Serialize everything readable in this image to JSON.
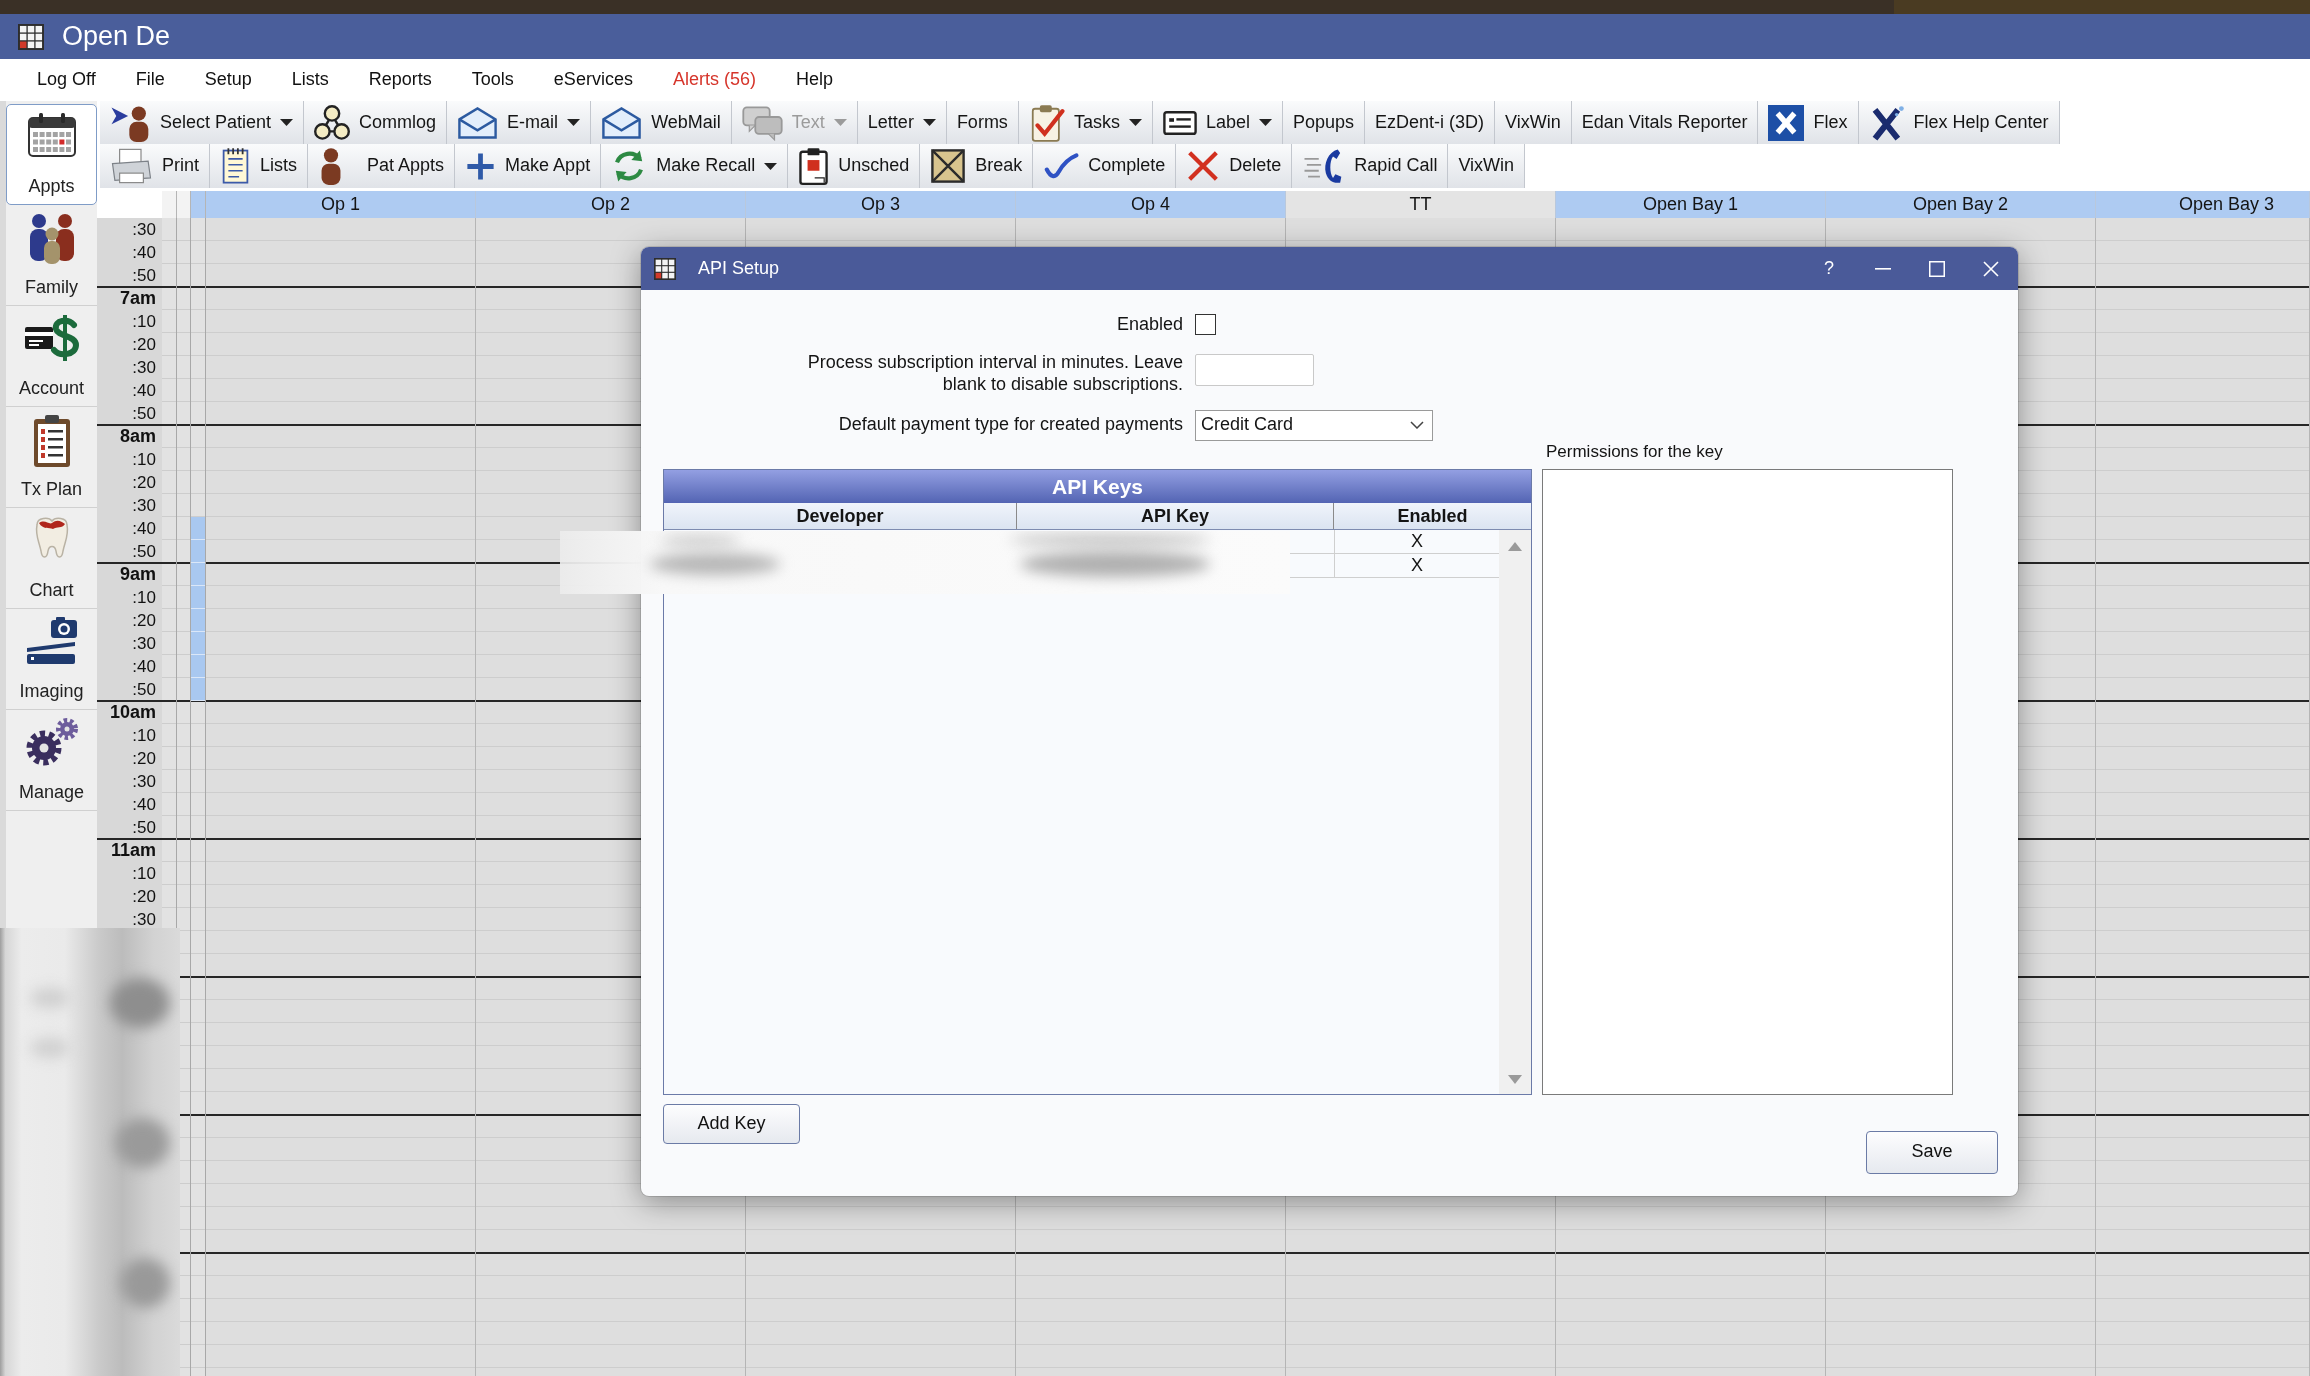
{
  "window": {
    "title": "Open De"
  },
  "menu": [
    {
      "label": "Log Off",
      "alert": false
    },
    {
      "label": "File",
      "alert": false
    },
    {
      "label": "Setup",
      "alert": false
    },
    {
      "label": "Lists",
      "alert": false
    },
    {
      "label": "Reports",
      "alert": false
    },
    {
      "label": "Tools",
      "alert": false
    },
    {
      "label": "eServices",
      "alert": false
    },
    {
      "label": "Alerts (56)",
      "alert": true
    },
    {
      "label": "Help",
      "alert": false
    }
  ],
  "toolbars": [
    {
      "buttons": [
        {
          "label": "Select Patient",
          "dropdown": true,
          "disabled": false
        },
        {
          "label": "Commlog",
          "dropdown": false,
          "disabled": false
        },
        {
          "label": "E-mail",
          "dropdown": true,
          "disabled": false
        },
        {
          "label": "WebMail",
          "dropdown": false,
          "disabled": false
        },
        {
          "label": "Text",
          "dropdown": true,
          "disabled": true
        },
        {
          "label": "Letter",
          "dropdown": true,
          "disabled": false
        },
        {
          "label": "Forms",
          "dropdown": false,
          "disabled": false
        },
        {
          "label": "Tasks",
          "dropdown": true,
          "disabled": false
        },
        {
          "label": "Label",
          "dropdown": true,
          "disabled": false
        },
        {
          "label": "Popups",
          "dropdown": false,
          "disabled": false
        },
        {
          "label": "EzDent-i (3D)",
          "dropdown": false,
          "disabled": false
        },
        {
          "label": "VixWin",
          "dropdown": false,
          "disabled": false
        },
        {
          "label": "Edan Vitals Reporter",
          "dropdown": false,
          "disabled": false
        },
        {
          "label": "Flex",
          "dropdown": false,
          "disabled": false
        },
        {
          "label": "Flex Help Center",
          "dropdown": false,
          "disabled": false
        }
      ]
    },
    {
      "buttons": [
        {
          "label": "Print",
          "dropdown": false,
          "disabled": false
        },
        {
          "label": "Lists",
          "dropdown": false,
          "disabled": false
        },
        {
          "label": "Pat Appts",
          "dropdown": false,
          "disabled": false
        },
        {
          "label": "Make Appt",
          "dropdown": false,
          "disabled": false
        },
        {
          "label": "Make Recall",
          "dropdown": true,
          "disabled": false
        },
        {
          "label": "Unsched",
          "dropdown": false,
          "disabled": false
        },
        {
          "label": "Break",
          "dropdown": false,
          "disabled": false
        },
        {
          "label": "Complete",
          "dropdown": false,
          "disabled": false
        },
        {
          "label": "Delete",
          "dropdown": false,
          "disabled": false
        },
        {
          "label": "Rapid Call",
          "dropdown": false,
          "disabled": false
        },
        {
          "label": "VixWin",
          "dropdown": false,
          "disabled": false
        }
      ]
    }
  ],
  "modules": [
    {
      "label": "Appts",
      "selected": true
    },
    {
      "label": "Family",
      "selected": false
    },
    {
      "label": "Account",
      "selected": false
    },
    {
      "label": "Tx Plan",
      "selected": false
    },
    {
      "label": "Chart",
      "selected": false
    },
    {
      "label": "Imaging",
      "selected": false
    },
    {
      "label": "Manage",
      "selected": false
    }
  ],
  "schedule": {
    "columns": [
      {
        "label": "Op 1",
        "highlighted": true
      },
      {
        "label": "Op 2",
        "highlighted": true
      },
      {
        "label": "Op 3",
        "highlighted": true
      },
      {
        "label": "Op 4",
        "highlighted": true
      },
      {
        "label": "TT",
        "highlighted": false
      },
      {
        "label": "Open Bay 1",
        "highlighted": true
      },
      {
        "label": "Open Bay 2",
        "highlighted": true
      },
      {
        "label": "Open Bay 3",
        "highlighted": true
      }
    ],
    "time_rows": [
      {
        "label": ":30",
        "kind": "minute",
        "marked": false
      },
      {
        "label": ":40",
        "kind": "minute",
        "marked": false
      },
      {
        "label": ":50",
        "kind": "minute",
        "marked": false
      },
      {
        "label": "7am",
        "kind": "hour",
        "marked": false
      },
      {
        "label": ":10",
        "kind": "minute",
        "marked": false
      },
      {
        "label": ":20",
        "kind": "minute",
        "marked": false
      },
      {
        "label": ":30",
        "kind": "minute",
        "marked": false
      },
      {
        "label": ":40",
        "kind": "minute",
        "marked": false
      },
      {
        "label": ":50",
        "kind": "minute",
        "marked": false
      },
      {
        "label": "8am",
        "kind": "hour",
        "marked": false
      },
      {
        "label": ":10",
        "kind": "minute",
        "marked": false
      },
      {
        "label": ":20",
        "kind": "minute",
        "marked": false
      },
      {
        "label": ":30",
        "kind": "minute",
        "marked": false
      },
      {
        "label": ":40",
        "kind": "minute",
        "marked": true
      },
      {
        "label": ":50",
        "kind": "minute",
        "marked": true
      },
      {
        "label": "9am",
        "kind": "hour",
        "marked": true
      },
      {
        "label": ":10",
        "kind": "minute",
        "marked": true
      },
      {
        "label": ":20",
        "kind": "minute",
        "marked": true
      },
      {
        "label": ":30",
        "kind": "minute",
        "marked": true
      },
      {
        "label": ":40",
        "kind": "minute",
        "marked": true
      },
      {
        "label": ":50",
        "kind": "minute",
        "marked": true
      },
      {
        "label": "10am",
        "kind": "hour",
        "marked": false
      },
      {
        "label": ":10",
        "kind": "minute",
        "marked": false
      },
      {
        "label": ":20",
        "kind": "minute",
        "marked": false
      },
      {
        "label": ":30",
        "kind": "minute",
        "marked": false
      },
      {
        "label": ":40",
        "kind": "minute",
        "marked": false
      },
      {
        "label": ":50",
        "kind": "minute",
        "marked": false
      },
      {
        "label": "11am",
        "kind": "hour",
        "marked": false
      },
      {
        "label": ":10",
        "kind": "minute",
        "marked": false
      },
      {
        "label": ":20",
        "kind": "minute",
        "marked": false
      },
      {
        "label": ":30",
        "kind": "minute",
        "marked": false
      }
    ]
  },
  "dialog": {
    "title": "API Setup",
    "help_button": "?",
    "enabled": {
      "label": "Enabled",
      "checked": false
    },
    "interval": {
      "label": "Process subscription interval in minutes. Leave blank to disable subscriptions."
    },
    "payment_type": {
      "label": "Default payment type for created payments",
      "value": "Credit Card"
    },
    "keys_table": {
      "title": "API Keys",
      "columns": [
        "Developer",
        "API Key",
        "Enabled"
      ],
      "rows": [
        {
          "enabled": "X"
        },
        {
          "enabled": "X"
        }
      ]
    },
    "permissions": {
      "label": "Permissions for the key"
    },
    "buttons": {
      "add": "Add Key",
      "save": "Save"
    }
  }
}
